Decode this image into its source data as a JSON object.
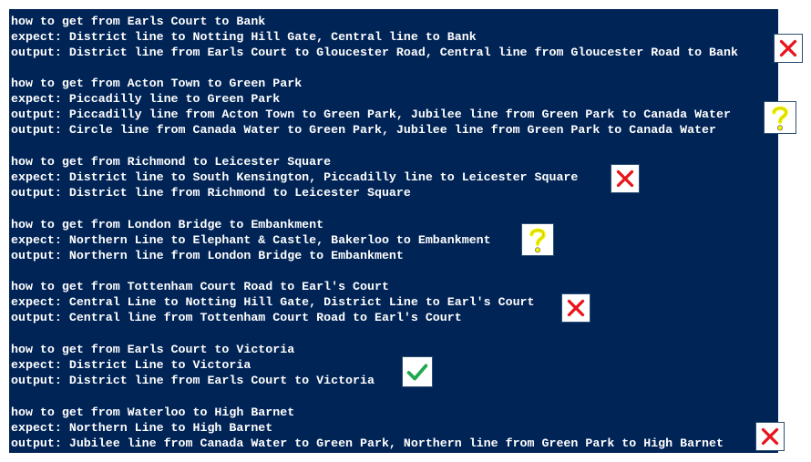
{
  "blocks": [
    {
      "lines": [
        "how to get from Earls Court to Bank",
        "expect: District line to Notting Hill Gate, Central line to Bank",
        "output: District line from Earls Court to Gloucester Road, Central line from Gloucester Road to Bank"
      ],
      "mark": "cross-icon"
    },
    {
      "lines": [
        "how to get from Acton Town to Green Park",
        "expect: Piccadilly line to Green Park",
        "output: Piccadilly line from Acton Town to Green Park, Jubilee line from Green Park to Canada Water",
        "output: Circle line from Canada Water to Green Park, Jubilee line from Green Park to Canada Water"
      ],
      "mark": "question-icon"
    },
    {
      "lines": [
        "how to get from Richmond to Leicester Square",
        "expect: District line to South Kensington, Piccadilly line to Leicester Square",
        "output: District line from Richmond to Leicester Square"
      ],
      "mark": "cross-icon"
    },
    {
      "lines": [
        "how to get from London Bridge to Embankment",
        "expect: Northern Line to Elephant & Castle, Bakerloo to Embankment",
        "output: Northern line from London Bridge to Embankment"
      ],
      "mark": "question-icon"
    },
    {
      "lines": [
        "how to get from Tottenham Court Road to Earl's Court",
        "expect: Central Line to Notting Hill Gate, District Line to Earl's Court",
        "output: Central line from Tottenham Court Road to Earl's Court"
      ],
      "mark": "cross-icon"
    },
    {
      "lines": [
        "how to get from Earls Court to Victoria",
        "expect: District Line to Victoria",
        "output: District line from Earls Court to Victoria"
      ],
      "mark": "check-icon"
    },
    {
      "lines": [
        "how to get from Waterloo to High Barnet",
        "expect: Northern Line to High Barnet",
        "output: Jubilee line from Canada Water to Green Park, Northern line from Green Park to High Barnet"
      ],
      "mark": "cross-icon"
    }
  ],
  "colors": {
    "terminal_background": "#012456",
    "text": "#ffffff",
    "cross": "#e8141c",
    "question": "#f2f200",
    "check": "#1fa84f"
  }
}
